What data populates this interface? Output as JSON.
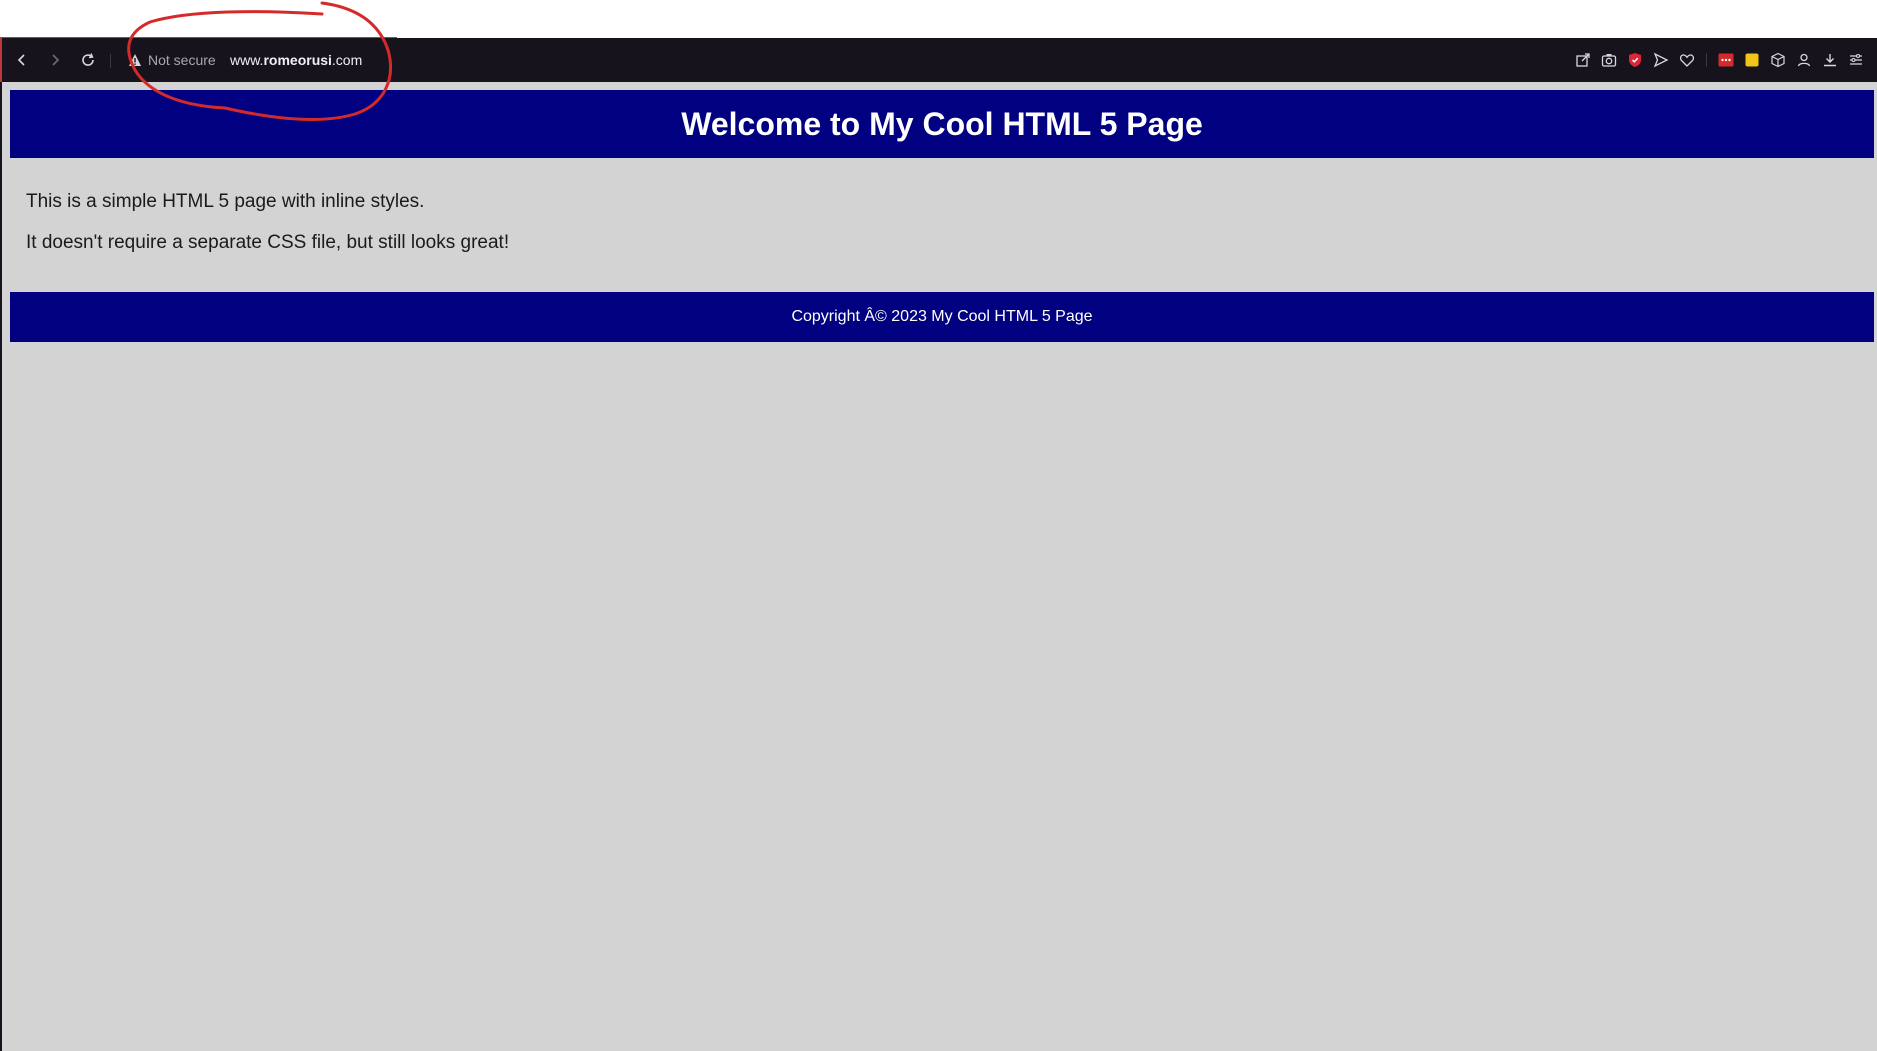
{
  "browser": {
    "security_label": "Not secure",
    "url_prefix": "www.",
    "url_domain": "romeorusi",
    "url_suffix": ".com",
    "icons": [
      "back-icon",
      "forward-icon",
      "reload-icon",
      "warning-icon",
      "share-icon",
      "camera-icon",
      "shield-icon",
      "send-icon",
      "heart-icon",
      "extension-red-icon",
      "extension-yellow-icon",
      "cube-icon",
      "profile-icon",
      "download-icon",
      "menu-icon"
    ]
  },
  "page": {
    "header_title": "Welcome to My Cool HTML 5 Page",
    "paragraphs": [
      "This is a simple HTML 5 page with inline styles.",
      "It doesn't require a separate CSS file, but still looks great!"
    ],
    "footer_text": "Copyright Â© 2023 My Cool HTML 5 Page"
  },
  "colors": {
    "header_bg": "#000080",
    "page_bg": "#d3d3d3",
    "toolbar_bg": "#16131d",
    "annotation": "#d42a2a"
  }
}
